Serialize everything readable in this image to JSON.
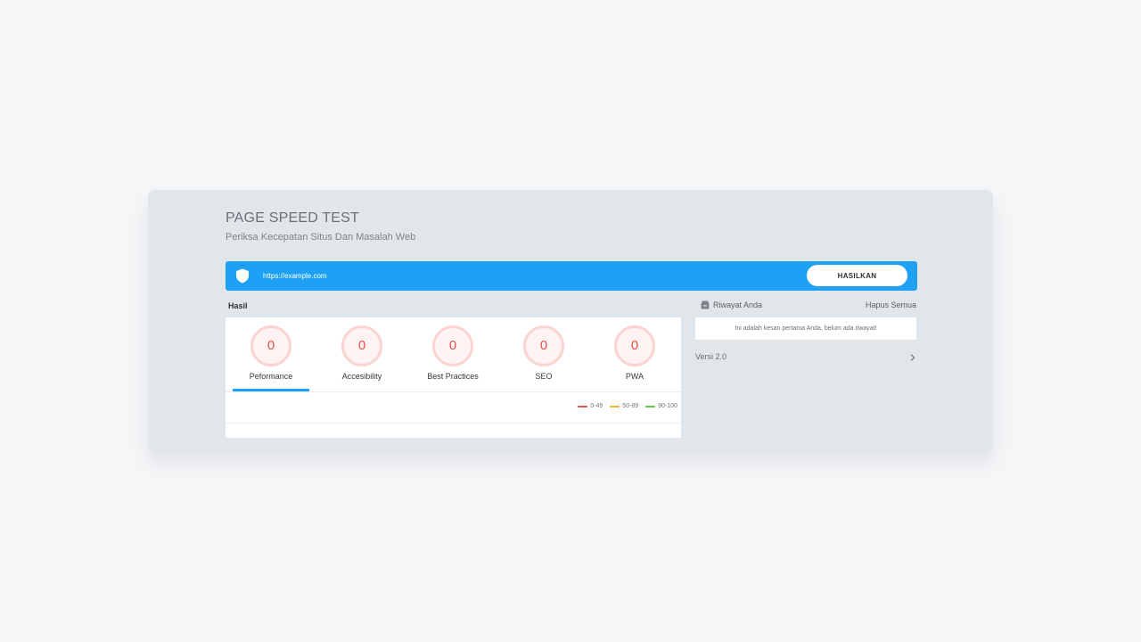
{
  "header": {
    "title": "PAGE SPEED TEST",
    "subtitle": "Periksa Kecepatan Situs Dan Masalah Web"
  },
  "search": {
    "url_value": "https://example.com",
    "button_label": "HASILKAN",
    "icon": "shield-icon"
  },
  "results": {
    "label": "Hasil",
    "active_tab": "Peformance",
    "tabs": [
      {
        "label": "Peformance",
        "score": "0"
      },
      {
        "label": "Accesibility",
        "score": "0"
      },
      {
        "label": "Best Practices",
        "score": "0"
      },
      {
        "label": "SEO",
        "score": "0"
      },
      {
        "label": "PWA",
        "score": "0"
      }
    ],
    "legend": [
      {
        "range": "0-49",
        "color": "#e2524d"
      },
      {
        "range": "50-89",
        "color": "#f2b431"
      },
      {
        "range": "90-100",
        "color": "#6cc04a"
      }
    ]
  },
  "history": {
    "icon": "inbox-icon",
    "title": "Riwayat Anda",
    "clear_label": "Hapus Semua",
    "empty_message": "Ini adalah kesan pertama Anda, belum ada riwayat!"
  },
  "version": {
    "label": "Versi 2.0",
    "icon": "chevron-right-icon"
  },
  "colors": {
    "accent": "#1ea0f4",
    "score_low": "#e2524d",
    "card_bg": "#e1e6ea"
  }
}
